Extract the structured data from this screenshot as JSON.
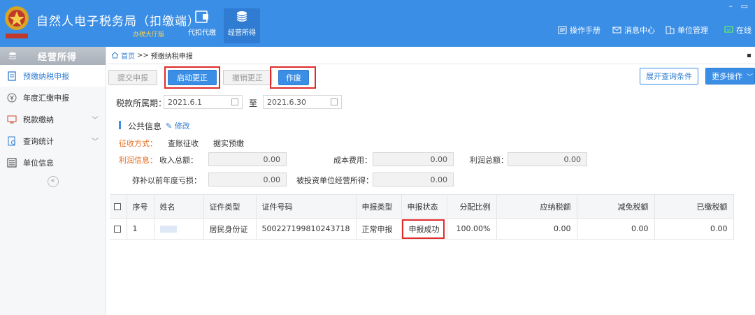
{
  "header": {
    "title": "自然人电子税务局（扣缴端）",
    "subtitle": "办税大厅版",
    "nav": [
      {
        "label": "代扣代缴",
        "icon": "folder-icon"
      },
      {
        "label": "经营所得",
        "icon": "coins-icon"
      }
    ],
    "right": [
      {
        "label": "操作手册",
        "icon": "manual-icon"
      },
      {
        "label": "消息中心",
        "icon": "mail-icon"
      },
      {
        "label": "单位管理",
        "icon": "building-icon"
      },
      {
        "label": "在线",
        "icon": "online-icon"
      }
    ],
    "colors": {
      "bar": "#3a8ee6",
      "accent_yellow": "#ffd34d"
    }
  },
  "sidebar": {
    "title": "经营所得",
    "items": [
      {
        "label": "预缴纳税申报",
        "icon": "report-icon",
        "active": true
      },
      {
        "label": "年度汇缴申报",
        "icon": "yen-icon"
      },
      {
        "label": "税款缴纳",
        "icon": "payment-icon",
        "expandable": true
      },
      {
        "label": "查询统计",
        "icon": "query-icon",
        "expandable": true
      },
      {
        "label": "单位信息",
        "icon": "list-icon"
      }
    ]
  },
  "breadcrumb": {
    "home": "首页",
    "sep": ">>",
    "current": "预缴纳税申报"
  },
  "toolbar": {
    "submit": "提交申报",
    "start_correction": "启动更正",
    "cancel_correction": "撤销更正",
    "void": "作废",
    "expand_query": "展开查询条件",
    "more_actions": "更多操作"
  },
  "period": {
    "label": "税款所属期：",
    "start": "2021.6.1",
    "to": "至",
    "end": "2021.6.30"
  },
  "public_info": {
    "title": "公共信息",
    "edit": "修改",
    "collection_label": "征收方式：",
    "collection_value1": "查账征收",
    "collection_value2": "据实预缴",
    "profit_label": "利润信息：",
    "income_label": "收入总额：",
    "income_value": "0.00",
    "cost_label": "成本费用：",
    "cost_value": "0.00",
    "profit_total_label": "利润总额：",
    "profit_total_value": "0.00",
    "loss_label": "弥补以前年度亏损：",
    "loss_value": "0.00",
    "invested_label": "被投资单位经营所得：",
    "invested_value": "0.00"
  },
  "table": {
    "headers": [
      "序号",
      "姓名",
      "证件类型",
      "证件号码",
      "申报类型",
      "申报状态",
      "分配比例",
      "应纳税额",
      "减免税额",
      "已缴税额"
    ],
    "rows": [
      {
        "no": "1",
        "id_type": "居民身份证",
        "id_no": "500227199810243718",
        "report_type": "正常申报",
        "status": "申报成功",
        "ratio": "100.00%",
        "tax_due": "0.00",
        "tax_relief": "0.00",
        "tax_paid": "0.00"
      }
    ]
  }
}
